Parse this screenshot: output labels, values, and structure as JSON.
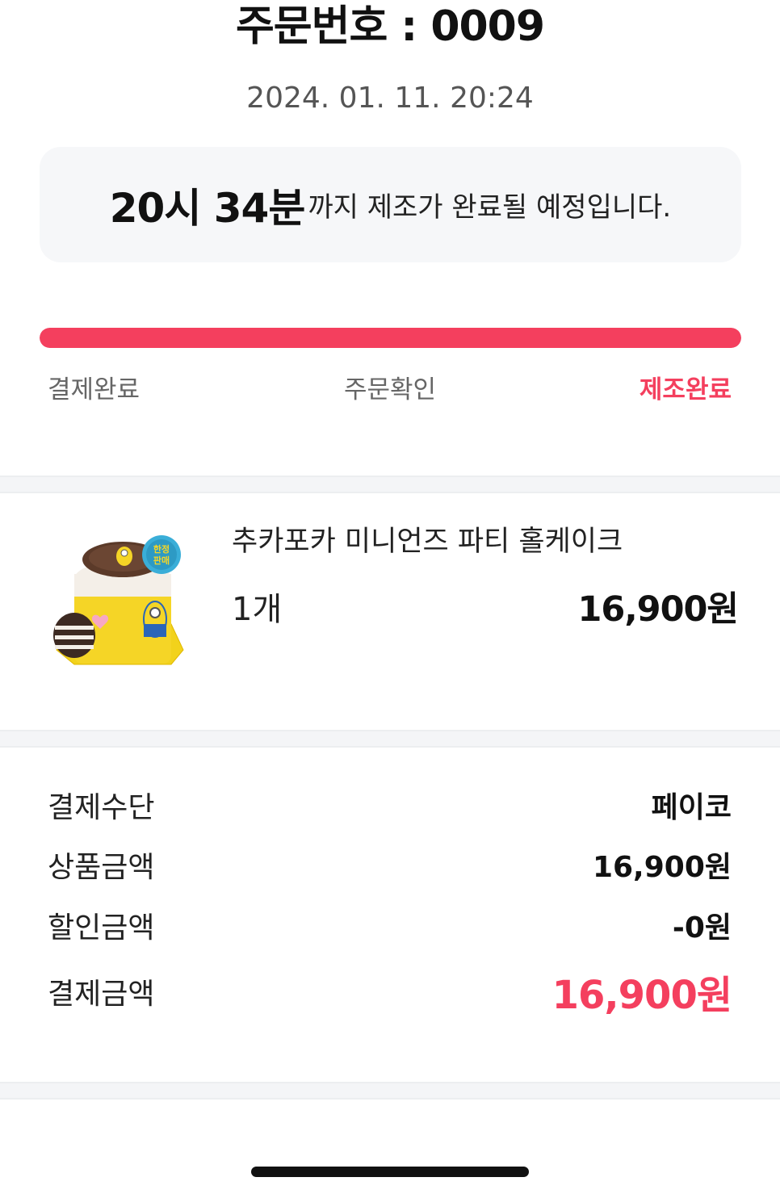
{
  "header": {
    "order_number": "주문번호 : 0009",
    "order_datetime": "2024. 01. 11. 20:24"
  },
  "eta": {
    "time": "20시 34분",
    "message": "까지 제조가 완료될 예정입니다."
  },
  "progress": {
    "fraction": 1.0,
    "color": "#f43f5e",
    "steps": [
      {
        "label": "결제완료",
        "active": false
      },
      {
        "label": "주문확인",
        "active": false
      },
      {
        "label": "제조완료",
        "active": true
      }
    ]
  },
  "product": {
    "name": "추카포카 미니언즈 파티 홀케이크",
    "quantity": "1개",
    "price": "16,900원",
    "badge": "한정판매",
    "image_icon": "minions-cake-image"
  },
  "payment": {
    "method_label": "결제수단",
    "method_value": "페이코",
    "product_amount_label": "상품금액",
    "product_amount_value": "16,900원",
    "discount_label": "할인금액",
    "discount_value": "-0원",
    "total_label": "결제금액",
    "total_value": "16,900원"
  },
  "colors": {
    "accent": "#f43f5e",
    "box_bg": "#f6f7f9"
  }
}
